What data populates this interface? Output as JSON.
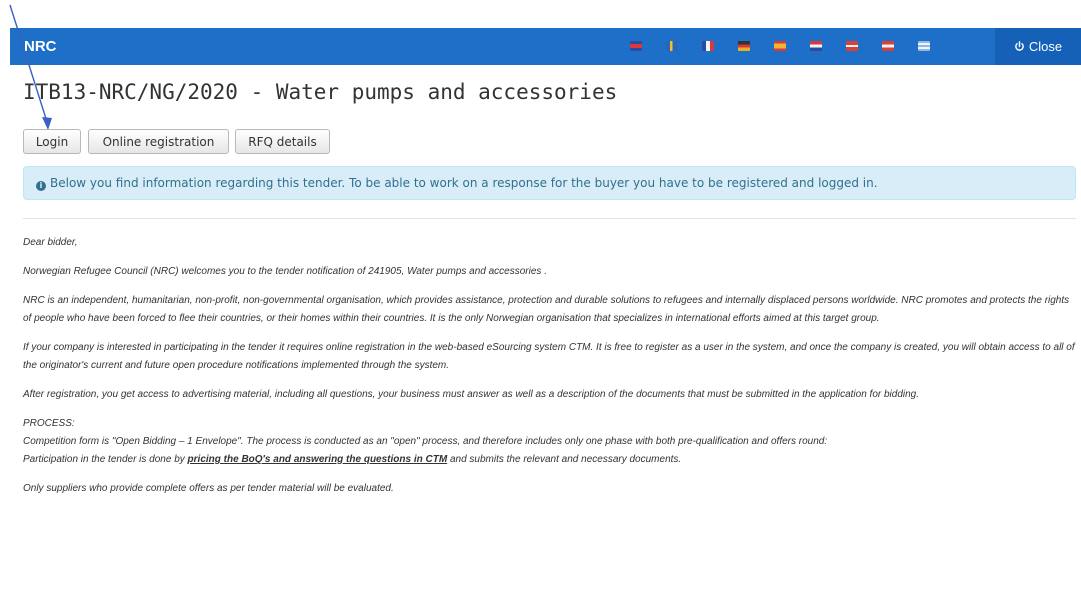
{
  "header": {
    "brand": "NRC",
    "close_label": "Close",
    "flags": [
      {
        "name": "uk-flag-icon",
        "color": "#d63a3a"
      },
      {
        "name": "sweden-flag-icon",
        "color": "#f2c027"
      },
      {
        "name": "france-flag-icon",
        "color": "#f4f4f4"
      },
      {
        "name": "germany-flag-icon",
        "color": "#e9b121"
      },
      {
        "name": "spain-flag-icon",
        "color": "#f1b62b"
      },
      {
        "name": "netherlands-flag-icon",
        "color": "#f4f4f4"
      },
      {
        "name": "denmark-flag-icon",
        "color": "#d9403a"
      },
      {
        "name": "norway-flag-icon",
        "color": "#d9403a"
      },
      {
        "name": "greece-flag-icon",
        "color": "#8fb7e8"
      }
    ]
  },
  "page": {
    "title": "ITB13-NRC/NG/2020 - Water pumps and accessories"
  },
  "buttons": {
    "login": "Login",
    "online_registration": "Online registration",
    "rfq_details": "RFQ details"
  },
  "info": {
    "text": "Below you find information regarding this tender. To be able to work on a response for the buyer you have to be registered and logged in."
  },
  "content": {
    "greeting": "Dear bidder,",
    "p1": "Norwegian Refugee Council (NRC) welcomes you to the tender notification of 241905, Water pumps and accessories .",
    "p2": "NRC is an independent, humanitarian, non-profit, non-governmental organisation, which provides assistance, protection and durable solutions to refugees and internally displaced persons worldwide. NRC promotes and protects the rights of people who have been forced to flee their countries, or their homes within their countries. It is the only Norwegian organisation that specializes in international efforts aimed at this target group.",
    "p3": "If your company is interested in participating in the tender it requires online registration in the web-based eSourcing system CTM. It is free to register as a user in the system, and once the company is created, you will obtain access to all of the originator's current and future open procedure notifications implemented through the system.",
    "p4": "After registration, you get access to advertising material, including all questions, your business must answer as well as a description of the documents that must be submitted in the application for bidding.",
    "process_heading": "PROCESS:",
    "process_line1": "Competition form is \"Open Bidding – 1 Envelope\". The process is conducted as an \"open\" process, and therefore includes only one phase with both pre-qualification and offers round:",
    "process_line2_pre": "Participation in the tender is done by ",
    "process_line2_emph": "pricing the BoQ's and answering the questions in CTM",
    "process_line2_post": " and submits the relevant and necessary documents.",
    "p5": "Only suppliers who provide complete offers as per tender material will be evaluated."
  }
}
